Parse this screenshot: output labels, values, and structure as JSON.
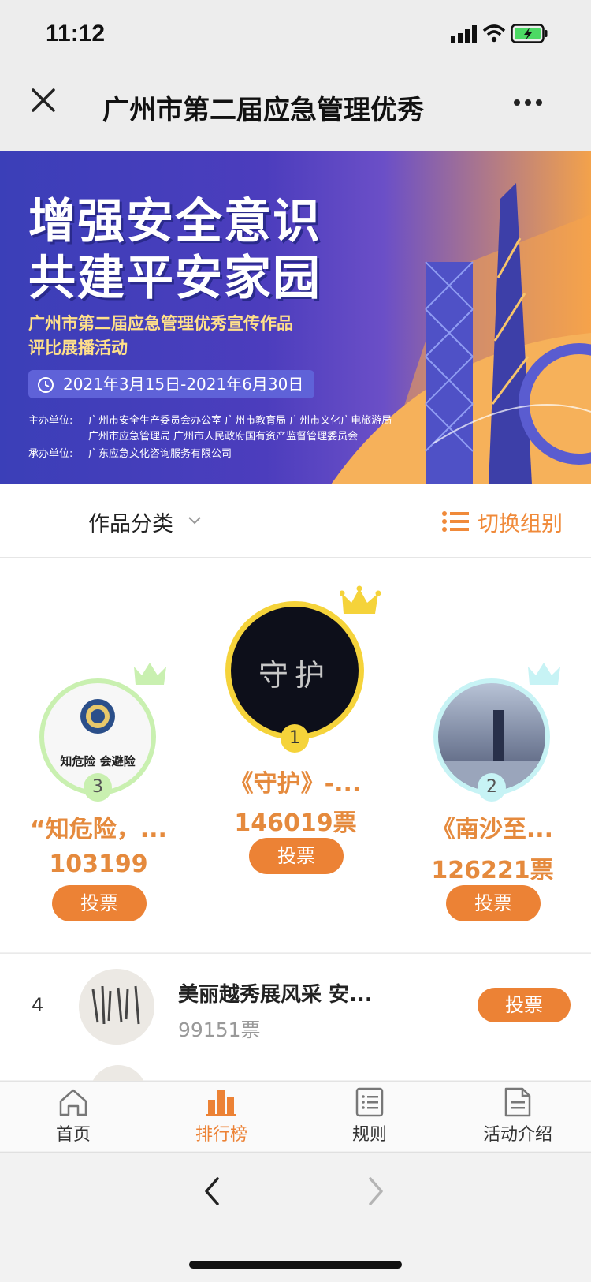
{
  "status_bar": {
    "time": "11:12"
  },
  "nav": {
    "title": "广州市第二届应急管理优秀"
  },
  "banner": {
    "headline_1": "增强安全意识",
    "headline_2": "共建平安家园",
    "subtitle_1": "广州市第二届应急管理优秀宣传作品",
    "subtitle_2": "评比展播活动",
    "date": "2021年3月15日-2021年6月30日",
    "organizer_label": "主办单位:",
    "organizer_line_1": "广州市安全生产委员会办公室    广州市教育局    广州市文化广电旅游局",
    "organizer_line_2": "广州市应急管理局    广州市人民政府国有资产监督管理委员会",
    "undertaker_label": "承办单位:",
    "undertaker": "广东应急文化咨询服务有限公司"
  },
  "filter": {
    "category_label": "作品分类",
    "switch_label": "切换组别"
  },
  "podium": {
    "first": {
      "rank": "1",
      "title": "《守护》-...",
      "votes": "146019票",
      "vote_button": "投票",
      "avatar_text": "守护"
    },
    "second": {
      "rank": "2",
      "title": "《南沙至...",
      "votes": "126221票",
      "vote_button": "投票"
    },
    "third": {
      "rank": "3",
      "title": "“知危险，...",
      "votes": "103199",
      "vote_button": "投票",
      "avatar_text": "知危险 会避险"
    }
  },
  "list": [
    {
      "rank": "4",
      "title": "美丽越秀展风采 安...",
      "votes": "99151票",
      "vote_button": "投票"
    }
  ],
  "tabs": [
    {
      "label": "首页",
      "icon": "home-icon",
      "active": false
    },
    {
      "label": "排行榜",
      "icon": "bar-chart-icon",
      "active": true
    },
    {
      "label": "规则",
      "icon": "rules-icon",
      "active": false
    },
    {
      "label": "活动介绍",
      "icon": "document-icon",
      "active": false
    }
  ],
  "colors": {
    "accent": "#ec8235",
    "gold": "#f5d33a",
    "green": "#a7e08a",
    "cyan": "#a8eef2"
  }
}
